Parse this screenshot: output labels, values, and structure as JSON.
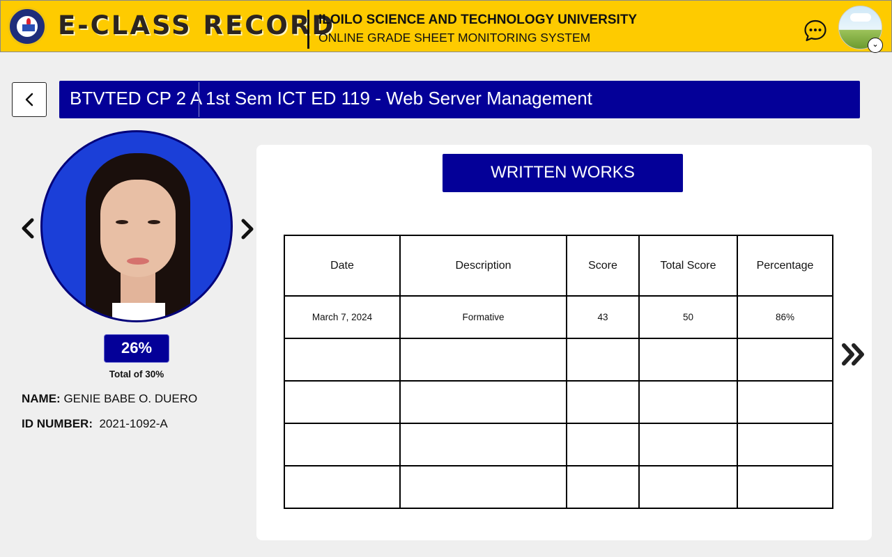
{
  "header": {
    "brand": "E-CLASS RECORD",
    "university": "ILOILO SCIENCE AND TECHNOLOGY UNIVERSITY",
    "system": "ONLINE GRADE SHEET MONITORING SYSTEM",
    "icons": [
      "university-seal",
      "chat-icon",
      "user-avatar",
      "chevron-down-icon"
    ],
    "colors": {
      "header_bg": "#fecb00",
      "primary": "#040098"
    }
  },
  "course": {
    "section": "BTVTED CP 2 A",
    "title": "1st Sem ICT ED 119 - Web Server Management"
  },
  "student": {
    "grade_percent": "26%",
    "grade_total": "Total of 30%",
    "name_label": "NAME:",
    "name": "GENIE BABE O. DUERO",
    "id_label": "ID NUMBER:",
    "id": "2021-1092-A"
  },
  "written_works": {
    "title": "WRITTEN WORKS",
    "columns": [
      "Date",
      "Description",
      "Score",
      "Total Score",
      "Percentage"
    ],
    "rows": [
      [
        "March 7, 2024",
        "Formative",
        "43",
        "50",
        "86%"
      ],
      [
        "",
        "",
        "",
        "",
        ""
      ],
      [
        "",
        "",
        "",
        "",
        ""
      ],
      [
        "",
        "",
        "",
        "",
        ""
      ],
      [
        "",
        "",
        "",
        "",
        ""
      ]
    ]
  }
}
